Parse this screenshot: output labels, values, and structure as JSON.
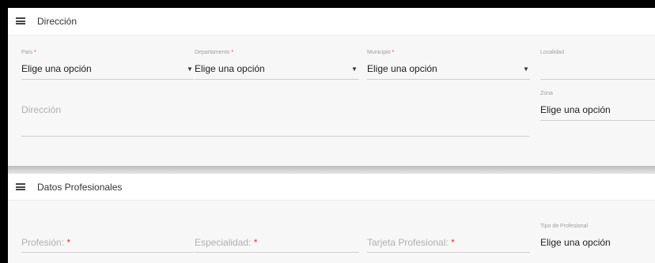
{
  "section1": {
    "title": "Dirección",
    "pais": {
      "label": "País",
      "value": "Elige una opción"
    },
    "departamento": {
      "label": "Departamento",
      "value": "Elige una opción"
    },
    "municipio": {
      "label": "Municipio",
      "value": "Elige una opción"
    },
    "localidad": {
      "label": "Localidad"
    },
    "direccion": {
      "placeholder": "Dirección"
    },
    "zona": {
      "label": "Zona",
      "value": "Elige una opción"
    },
    "required_mark": "*"
  },
  "section2": {
    "title": "Datos Profesionales",
    "profesion": {
      "placeholder": "Profesión:"
    },
    "especialidad": {
      "placeholder": "Especialidad:"
    },
    "tarjeta": {
      "placeholder": "Tarjeta Profesional:"
    },
    "tipo": {
      "label": "Tipo de Profesional",
      "value": "Elige una opción"
    },
    "required_mark": "*"
  },
  "icons": {
    "menu": "hamburger-menu-icon",
    "dropdown": "caret-down-icon"
  },
  "colors": {
    "required": "#e53935",
    "label": "#9e9e9e",
    "text": "#212121"
  }
}
